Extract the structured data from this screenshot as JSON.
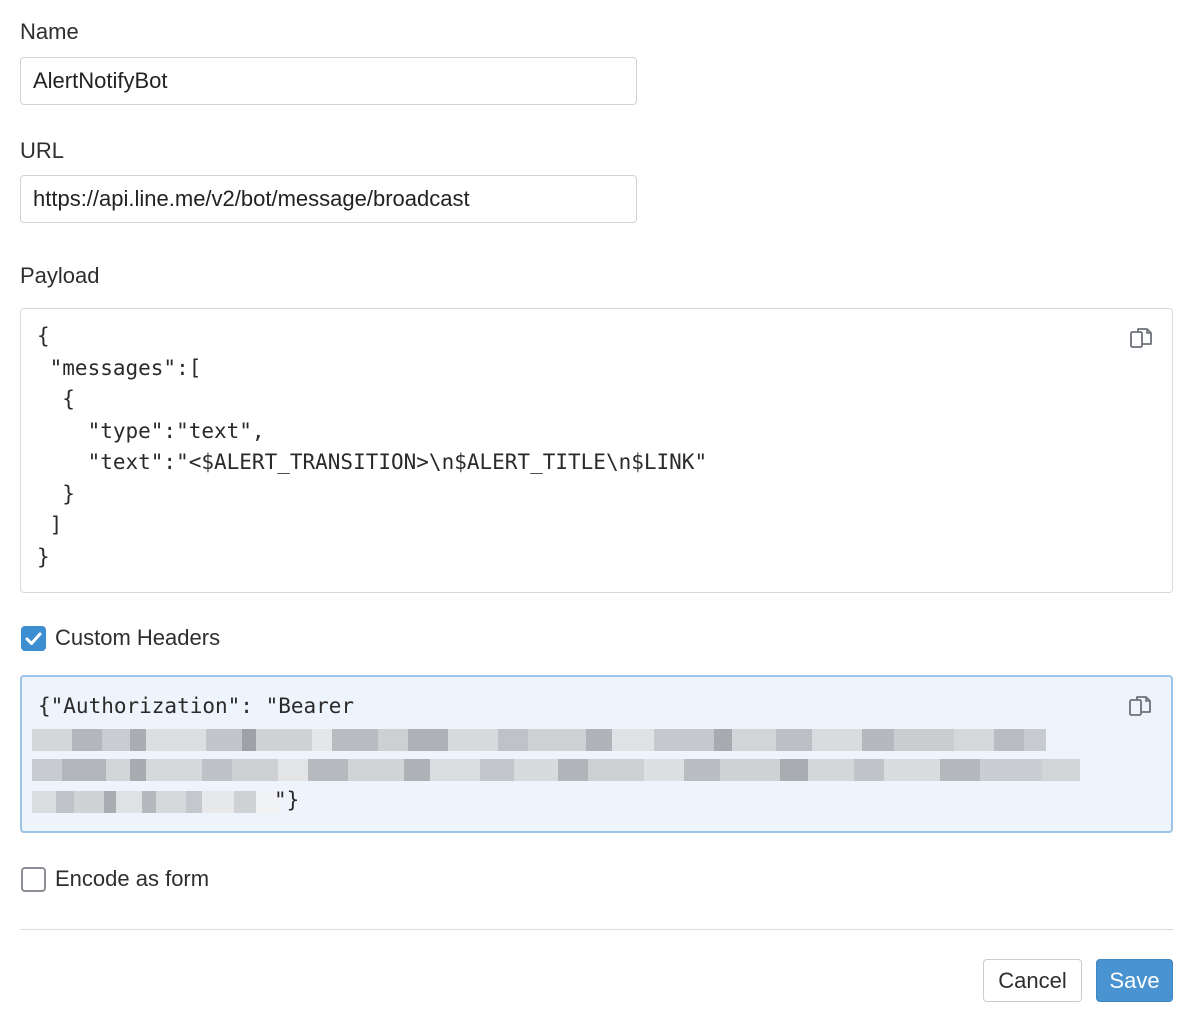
{
  "name": {
    "label": "Name",
    "value": "AlertNotifyBot"
  },
  "url": {
    "label": "URL",
    "value": "https://api.line.me/v2/bot/message/broadcast"
  },
  "payload": {
    "label": "Payload",
    "code": "{\n \"messages\":[\n  {\n    \"type\":\"text\",\n    \"text\":\"<$ALERT_TRANSITION>\\n$ALERT_TITLE\\n$LINK\"\n  }\n ]\n}",
    "copy_icon": "copy-icon"
  },
  "custom_headers": {
    "label": "Custom Headers",
    "checked": true,
    "code_first_line": "{\"Authorization\": \"Bearer",
    "code_tail": "\"}",
    "redacted": true,
    "copy_icon": "copy-icon"
  },
  "encode_as_form": {
    "label": "Encode as form",
    "checked": false
  },
  "actions": {
    "cancel_label": "Cancel",
    "save_label": "Save"
  },
  "colors": {
    "primary": "#4a93d1",
    "checkbox_checked": "#3d8ed0",
    "active_field_bg": "#eef4fb",
    "active_field_border": "#9dc3e6"
  }
}
